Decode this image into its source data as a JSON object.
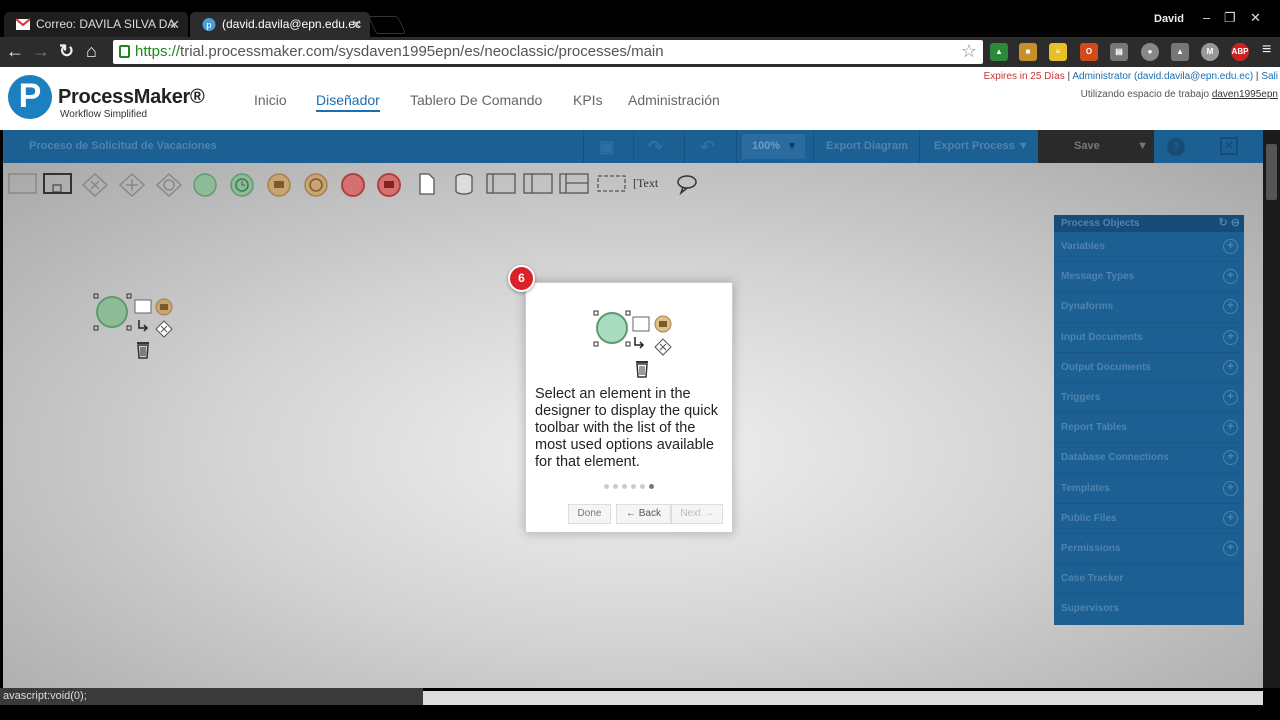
{
  "browser": {
    "tabs": [
      {
        "title": "Correo: DAVILA SILVA DA",
        "close": "✕"
      },
      {
        "title": "(david.davila@epn.edu.ec",
        "close": "✕"
      }
    ],
    "user": "David",
    "url_https": "https://",
    "url_rest": "trial.processmaker.com/sysdaven1995epn/es/neoclassic/processes/main",
    "status_text": "avascript:void(0);"
  },
  "header": {
    "logo_letter": "P",
    "brand": "ProcessMaker®",
    "tagline": "Workflow Simplified",
    "nav": [
      "Inicio",
      "Diseñador",
      "Tablero De Comando",
      "KPIs",
      "Administración"
    ],
    "expires": "Expires in 25 Días",
    "sep": " | ",
    "admin": "Administrator (david.davila@epn.edu.ec)",
    "logout": "Sali",
    "workspace_label": "Utilizando espacio de trabajo ",
    "workspace": "daven1995epn"
  },
  "designer": {
    "process_title": "Proceso de Solicitud de Vacaciones",
    "zoom": "100%",
    "export_diagram": "Export Diagram",
    "export_process": "Export Process ▼",
    "save": "Save",
    "text_tool": "Text"
  },
  "process_objects": {
    "title": "Process Objects",
    "items": [
      "Variables",
      "Message Types",
      "Dynaforms",
      "Input Documents",
      "Output Documents",
      "Triggers",
      "Report Tables",
      "Database Connections",
      "Templates",
      "Public Files",
      "Permissions",
      "Case Tracker",
      "Supervisors"
    ]
  },
  "tour": {
    "step": "6",
    "text": "Select an element in the designer to display the quick toolbar with the list of the most used options available for that element.",
    "done": "Done",
    "back": "← Back",
    "next": "Next →"
  },
  "colors": {
    "designer_blue": "#1c5f93",
    "brand_blue": "#1b7fc0",
    "badge_red": "#d9232a"
  }
}
